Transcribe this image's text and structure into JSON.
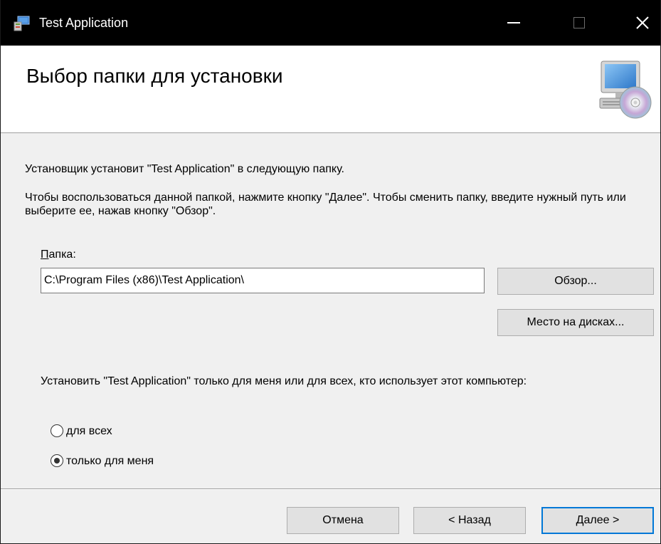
{
  "window": {
    "title": "Test Application",
    "app_icon": "installer-icon",
    "controls": {
      "minimize_icon": "minimize-icon",
      "maximize_icon": "maximize-icon",
      "close_label": "✕"
    }
  },
  "banner": {
    "title": "Выбор папки для установки",
    "icon": "computer-disc-icon"
  },
  "body": {
    "intro": "Установщик установит \"Test Application\" в следующую папку.",
    "instructions": "Чтобы воспользоваться данной папкой, нажмите кнопку \"Далее\". Чтобы сменить папку, введите нужный путь или выберите ее, нажав кнопку \"Обзор\".",
    "folder_label_underlined": "П",
    "folder_label_rest": "апка:",
    "folder_path": "C:\\Program Files (x86)\\Test Application\\",
    "browse_label": "Обзор...",
    "disk_cost_label": "Место на дисках...",
    "scope_label": "Установить \"Test Application\" только для меня или для всех, кто использует этот компьютер:",
    "radio_options": [
      {
        "label": "для всех",
        "selected": false
      },
      {
        "label": "только для меня",
        "selected": true
      }
    ]
  },
  "footer": {
    "cancel_label": "Отмена",
    "back_label": "< Назад",
    "next_label": "Далее >"
  },
  "colors": {
    "titlebar": "#000000",
    "accent": "#0078d7",
    "dialog_bg": "#f0f0f0",
    "button_bg": "#e1e1e1"
  }
}
